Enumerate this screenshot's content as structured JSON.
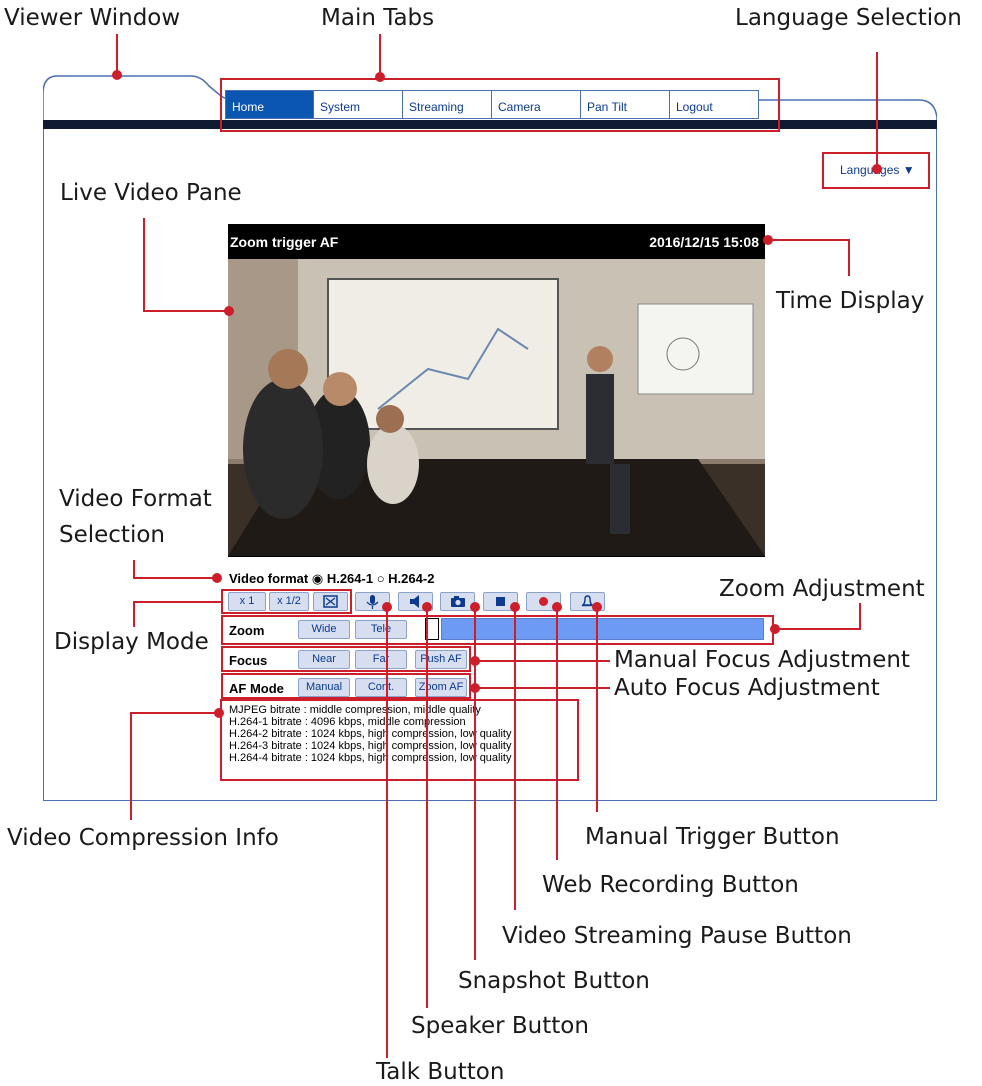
{
  "callouts": {
    "viewer_window": "Viewer Window",
    "main_tabs": "Main Tabs",
    "language_selection": "Language Selection",
    "live_video_pane": "Live Video Pane",
    "time_display": "Time Display",
    "video_format_selection_1": "Video Format",
    "video_format_selection_2": "Selection",
    "zoom_adjustment": "Zoom Adjustment",
    "display_mode": "Display Mode",
    "manual_focus_adjustment": "Manual Focus Adjustment",
    "auto_focus_adjustment": "Auto Focus Adjustment",
    "video_compression_info": "Video Compression Info",
    "manual_trigger_button": "Manual Trigger Button",
    "web_recording_button": "Web Recording Button",
    "video_streaming_pause_button": "Video Streaming Pause Button",
    "snapshot_button": "Snapshot Button",
    "speaker_button": "Speaker Button",
    "talk_button": "Talk Button"
  },
  "tabs": [
    "Home",
    "System",
    "Streaming",
    "Camera",
    "Pan Tilt",
    "Logout"
  ],
  "active_tab": "Home",
  "languages_label": "Languages ▼",
  "video": {
    "title": "Zoom trigger AF",
    "timestamp": "2016/12/15 15:08"
  },
  "video_format": {
    "label": "Video format",
    "option1": "H.264-1",
    "option2": "H.264-2",
    "selected": "H.264-1"
  },
  "display_mode": {
    "x1": "x 1",
    "x12": "x 1/2"
  },
  "zoom": {
    "label": "Zoom",
    "wide": "Wide",
    "tele": "Tele"
  },
  "focus": {
    "label": "Focus",
    "near": "Near",
    "far": "Far",
    "push_af": "Push AF"
  },
  "af_mode": {
    "label": "AF Mode",
    "manual": "Manual",
    "cont": "Cont.",
    "zoom_af": "Zoom AF"
  },
  "bitrates": [
    "MJPEG bitrate : middle compression, middle quality",
    "H.264-1 bitrate : 4096 kbps, middle compression",
    "H.264-2 bitrate : 1024 kbps, high compression, low quality",
    "H.264-3 bitrate : 1024 kbps, high compression, low quality",
    "H.264-4 bitrate : 1024 kbps, high compression, low quality"
  ],
  "colors": {
    "accent": "#cc1f2b",
    "nav_active": "#0b56b0",
    "zoom_bar": "#6d9af2"
  }
}
